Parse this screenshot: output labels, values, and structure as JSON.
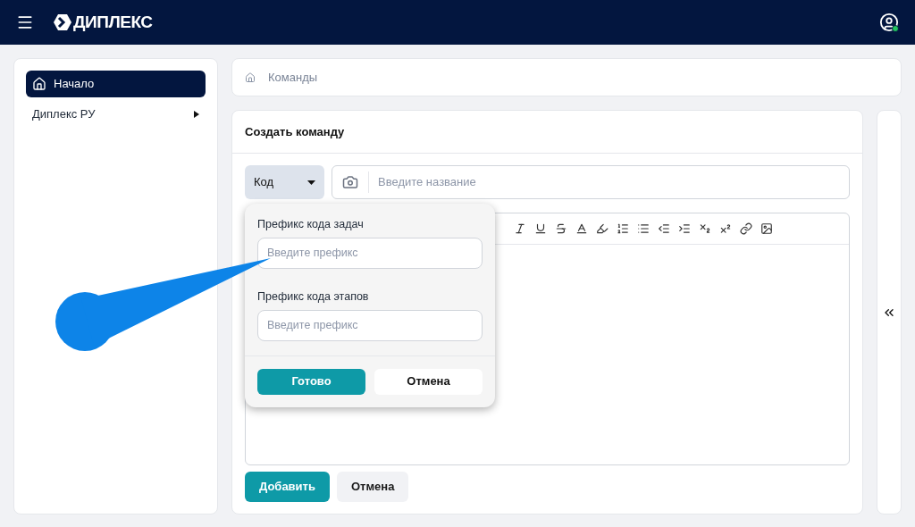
{
  "header": {
    "logo_text": "ДИПЛЕКС"
  },
  "sidebar": {
    "items": [
      {
        "label": "Начало",
        "selected": true,
        "kind": "home"
      },
      {
        "label": "Диплекс РУ",
        "selected": false,
        "kind": "group"
      }
    ]
  },
  "breadcrumb": {
    "label": "Команды"
  },
  "form": {
    "title": "Создать команду",
    "code_button": "Код",
    "name_field": {
      "placeholder": "Введите название"
    },
    "actions": [
      {
        "label": "Добавить",
        "kind": "primary"
      },
      {
        "label": "Отмена",
        "kind": "secondary"
      }
    ]
  },
  "popup": {
    "fields": [
      {
        "label": "Префикс кода задач",
        "placeholder": "Введите префикс"
      },
      {
        "label": "Префикс кода этапов",
        "placeholder": "Введите префикс"
      }
    ],
    "actions": [
      {
        "label": "Готово",
        "kind": "primary"
      },
      {
        "label": "Отмена",
        "kind": "secondary"
      }
    ]
  }
}
